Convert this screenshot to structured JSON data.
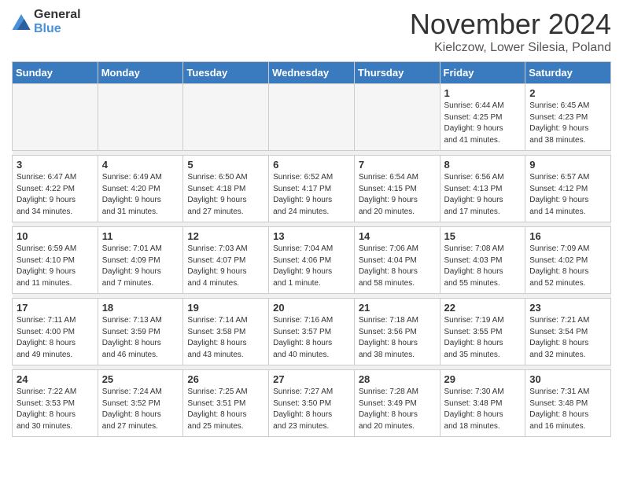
{
  "logo": {
    "general": "General",
    "blue": "Blue"
  },
  "header": {
    "month": "November 2024",
    "location": "Kielczow, Lower Silesia, Poland"
  },
  "days_of_week": [
    "Sunday",
    "Monday",
    "Tuesday",
    "Wednesday",
    "Thursday",
    "Friday",
    "Saturday"
  ],
  "weeks": [
    [
      {
        "day": "",
        "info": ""
      },
      {
        "day": "",
        "info": ""
      },
      {
        "day": "",
        "info": ""
      },
      {
        "day": "",
        "info": ""
      },
      {
        "day": "",
        "info": ""
      },
      {
        "day": "1",
        "info": "Sunrise: 6:44 AM\nSunset: 4:25 PM\nDaylight: 9 hours\nand 41 minutes."
      },
      {
        "day": "2",
        "info": "Sunrise: 6:45 AM\nSunset: 4:23 PM\nDaylight: 9 hours\nand 38 minutes."
      }
    ],
    [
      {
        "day": "3",
        "info": "Sunrise: 6:47 AM\nSunset: 4:22 PM\nDaylight: 9 hours\nand 34 minutes."
      },
      {
        "day": "4",
        "info": "Sunrise: 6:49 AM\nSunset: 4:20 PM\nDaylight: 9 hours\nand 31 minutes."
      },
      {
        "day": "5",
        "info": "Sunrise: 6:50 AM\nSunset: 4:18 PM\nDaylight: 9 hours\nand 27 minutes."
      },
      {
        "day": "6",
        "info": "Sunrise: 6:52 AM\nSunset: 4:17 PM\nDaylight: 9 hours\nand 24 minutes."
      },
      {
        "day": "7",
        "info": "Sunrise: 6:54 AM\nSunset: 4:15 PM\nDaylight: 9 hours\nand 20 minutes."
      },
      {
        "day": "8",
        "info": "Sunrise: 6:56 AM\nSunset: 4:13 PM\nDaylight: 9 hours\nand 17 minutes."
      },
      {
        "day": "9",
        "info": "Sunrise: 6:57 AM\nSunset: 4:12 PM\nDaylight: 9 hours\nand 14 minutes."
      }
    ],
    [
      {
        "day": "10",
        "info": "Sunrise: 6:59 AM\nSunset: 4:10 PM\nDaylight: 9 hours\nand 11 minutes."
      },
      {
        "day": "11",
        "info": "Sunrise: 7:01 AM\nSunset: 4:09 PM\nDaylight: 9 hours\nand 7 minutes."
      },
      {
        "day": "12",
        "info": "Sunrise: 7:03 AM\nSunset: 4:07 PM\nDaylight: 9 hours\nand 4 minutes."
      },
      {
        "day": "13",
        "info": "Sunrise: 7:04 AM\nSunset: 4:06 PM\nDaylight: 9 hours\nand 1 minute."
      },
      {
        "day": "14",
        "info": "Sunrise: 7:06 AM\nSunset: 4:04 PM\nDaylight: 8 hours\nand 58 minutes."
      },
      {
        "day": "15",
        "info": "Sunrise: 7:08 AM\nSunset: 4:03 PM\nDaylight: 8 hours\nand 55 minutes."
      },
      {
        "day": "16",
        "info": "Sunrise: 7:09 AM\nSunset: 4:02 PM\nDaylight: 8 hours\nand 52 minutes."
      }
    ],
    [
      {
        "day": "17",
        "info": "Sunrise: 7:11 AM\nSunset: 4:00 PM\nDaylight: 8 hours\nand 49 minutes."
      },
      {
        "day": "18",
        "info": "Sunrise: 7:13 AM\nSunset: 3:59 PM\nDaylight: 8 hours\nand 46 minutes."
      },
      {
        "day": "19",
        "info": "Sunrise: 7:14 AM\nSunset: 3:58 PM\nDaylight: 8 hours\nand 43 minutes."
      },
      {
        "day": "20",
        "info": "Sunrise: 7:16 AM\nSunset: 3:57 PM\nDaylight: 8 hours\nand 40 minutes."
      },
      {
        "day": "21",
        "info": "Sunrise: 7:18 AM\nSunset: 3:56 PM\nDaylight: 8 hours\nand 38 minutes."
      },
      {
        "day": "22",
        "info": "Sunrise: 7:19 AM\nSunset: 3:55 PM\nDaylight: 8 hours\nand 35 minutes."
      },
      {
        "day": "23",
        "info": "Sunrise: 7:21 AM\nSunset: 3:54 PM\nDaylight: 8 hours\nand 32 minutes."
      }
    ],
    [
      {
        "day": "24",
        "info": "Sunrise: 7:22 AM\nSunset: 3:53 PM\nDaylight: 8 hours\nand 30 minutes."
      },
      {
        "day": "25",
        "info": "Sunrise: 7:24 AM\nSunset: 3:52 PM\nDaylight: 8 hours\nand 27 minutes."
      },
      {
        "day": "26",
        "info": "Sunrise: 7:25 AM\nSunset: 3:51 PM\nDaylight: 8 hours\nand 25 minutes."
      },
      {
        "day": "27",
        "info": "Sunrise: 7:27 AM\nSunset: 3:50 PM\nDaylight: 8 hours\nand 23 minutes."
      },
      {
        "day": "28",
        "info": "Sunrise: 7:28 AM\nSunset: 3:49 PM\nDaylight: 8 hours\nand 20 minutes."
      },
      {
        "day": "29",
        "info": "Sunrise: 7:30 AM\nSunset: 3:48 PM\nDaylight: 8 hours\nand 18 minutes."
      },
      {
        "day": "30",
        "info": "Sunrise: 7:31 AM\nSunset: 3:48 PM\nDaylight: 8 hours\nand 16 minutes."
      }
    ]
  ]
}
